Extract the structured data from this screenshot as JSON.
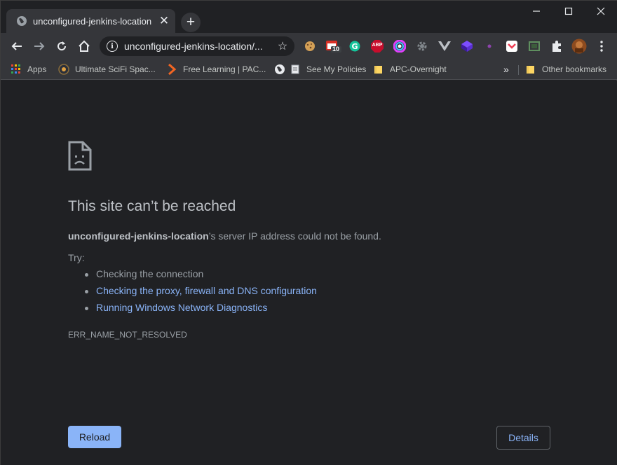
{
  "tab": {
    "title": "unconfigured-jenkins-location",
    "close_glyph": "✕"
  },
  "new_tab_glyph": "+",
  "window_controls": {
    "minimize": "─",
    "maximize": "☐",
    "close": "✕"
  },
  "omnibox": {
    "url": "unconfigured-jenkins-location/...",
    "info_glyph": "i",
    "star_glyph": "☆"
  },
  "extensions": [
    "cookie-icon",
    "calendar-icon",
    "grammarly-icon",
    "adblock-plus-icon",
    "color-picker-icon",
    "settings-gear-icon",
    "vue-devtools-icon",
    "cube-icon",
    "dot-icon",
    "pocket-icon",
    "screen-capture-icon",
    "puzzle-icon",
    "profile-avatar-icon",
    "more-icon"
  ],
  "extension_badges": {
    "calendar": "10",
    "adblock": "ABP"
  },
  "bookmarks": {
    "items": [
      {
        "label": "Apps",
        "icon": "apps-grid-icon"
      },
      {
        "label": "Ultimate SciFi Spac...",
        "icon": "scifi-icon"
      },
      {
        "label": "Free Learning | PAC...",
        "icon": "packt-icon"
      },
      {
        "label": "",
        "icon": "globe-icon"
      },
      {
        "label": "See My Policies",
        "icon": "page-icon"
      },
      {
        "label": "APC-Overnight",
        "icon": "folder-icon"
      }
    ],
    "overflow": "»",
    "other": "Other bookmarks"
  },
  "error": {
    "heading": "This site can’t be reached",
    "host": "unconfigured-jenkins-location",
    "summary_rest": "’s server IP address could not be found.",
    "try_label": "Try:",
    "suggestions": [
      "Checking the connection",
      "Checking the proxy, firewall and DNS configuration",
      "Running Windows Network Diagnostics"
    ],
    "code": "ERR_NAME_NOT_RESOLVED"
  },
  "buttons": {
    "reload": "Reload",
    "details": "Details"
  },
  "colors": {
    "background": "#202124",
    "toolbar": "#35363a",
    "link": "#8ab4f8",
    "text": "#9aa0a6",
    "heading": "#bdc1c6"
  }
}
